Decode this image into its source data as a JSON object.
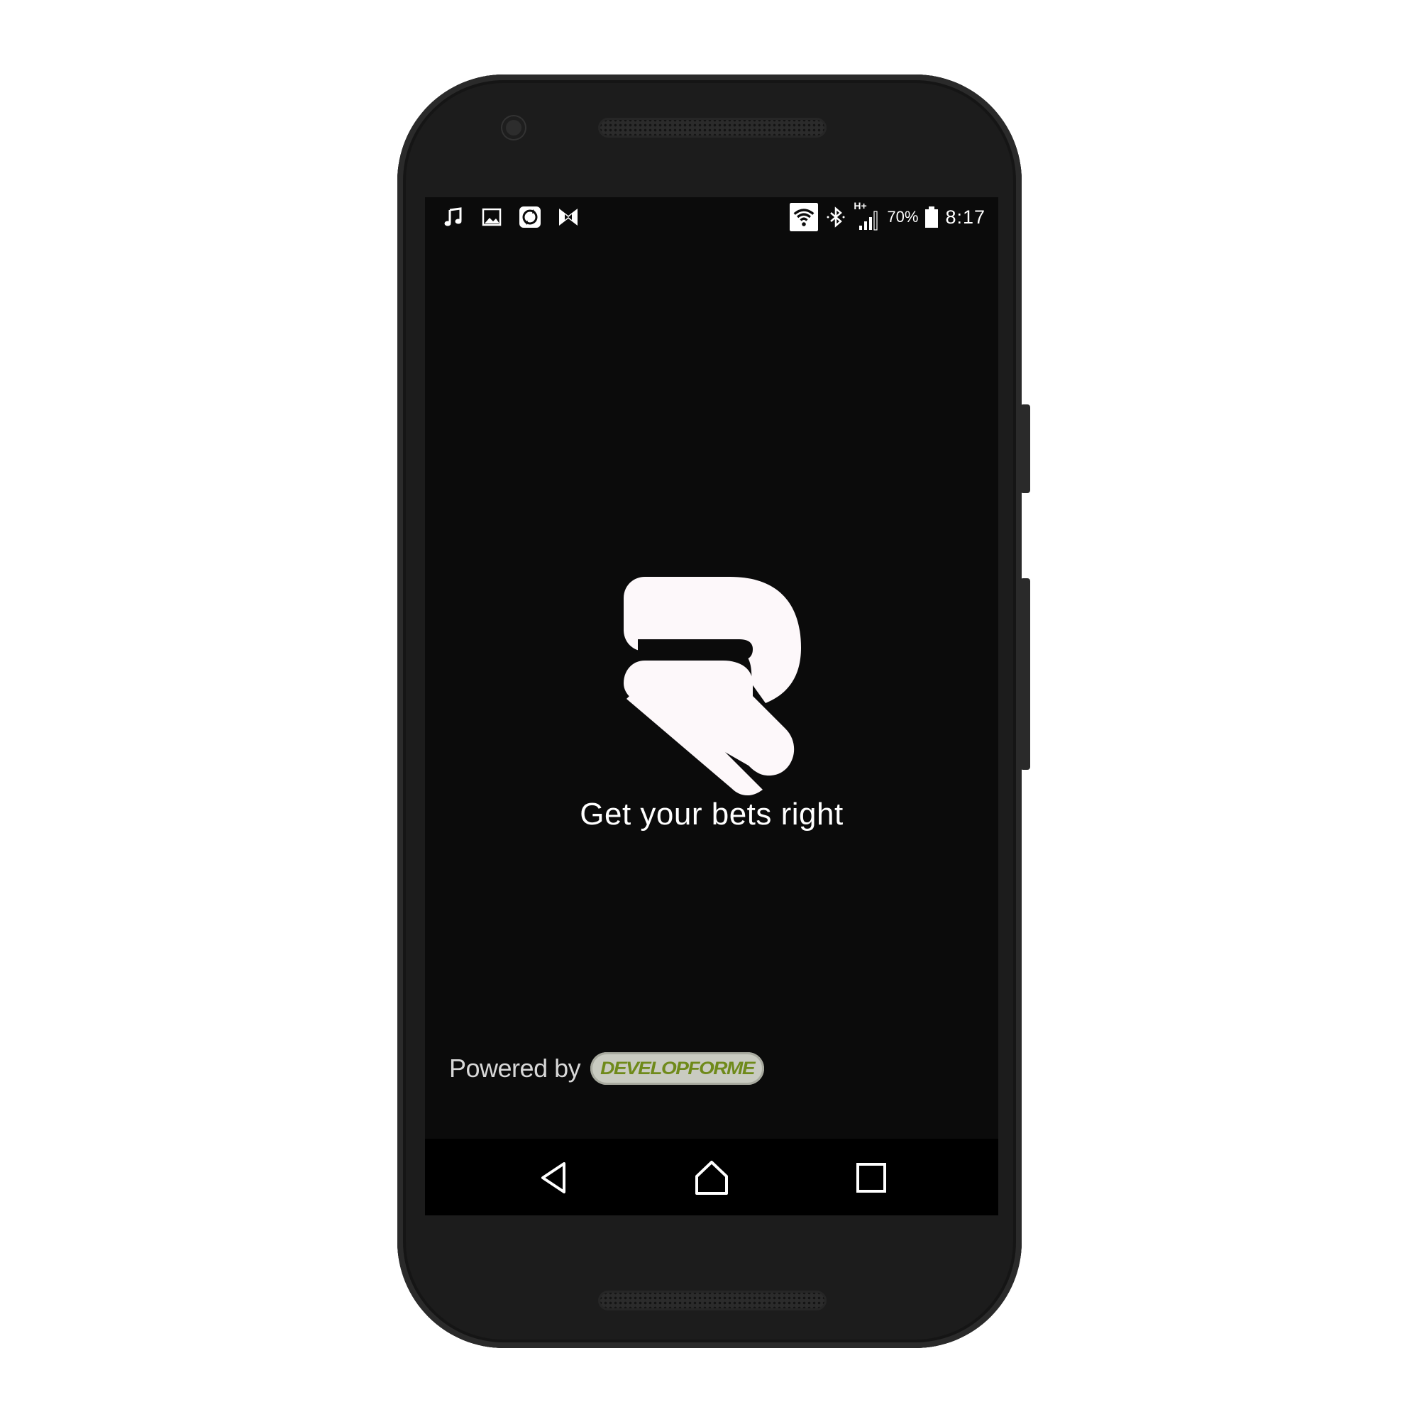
{
  "status_bar": {
    "left_icons": [
      "music-note-icon",
      "image-icon",
      "sync-app-icon",
      "bow-app-icon"
    ],
    "right_icons": [
      "wifi-icon",
      "bluetooth-icon",
      "signal-icon",
      "battery-icon"
    ],
    "network_type": "H+",
    "battery_percent": "70%",
    "time": "8:17"
  },
  "splash": {
    "logo_icon": "r-logo-icon",
    "tagline": "Get your bets right",
    "powered_by_label": "Powered by",
    "brand_name": "DEVELOPFORME"
  },
  "navigation": {
    "back": "back-triangle-icon",
    "home": "home-icon",
    "recents": "recents-square-icon"
  },
  "colors": {
    "screen_background": "#0b0b0b",
    "logo_fill": "#fdf8fa",
    "brand_badge": "#c9cbc1",
    "brand_text": "#6f8a1a"
  }
}
